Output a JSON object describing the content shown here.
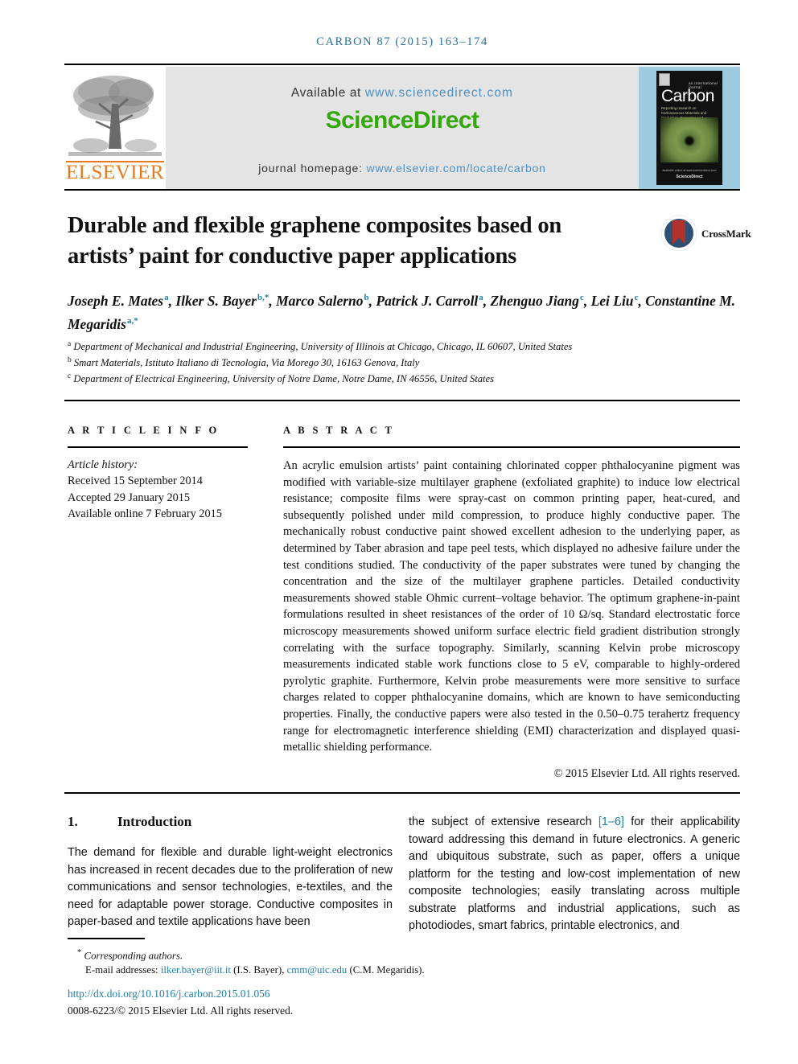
{
  "running_head": {
    "journal": "CARBON",
    "citation": "87 (2015) 163–174",
    "full": "CARBON 87 (2015) 163–174"
  },
  "banner": {
    "publisher_logo_text": "ELSEVIER",
    "available_prefix": "Available at",
    "available_url": "www.sciencedirect.com",
    "sciencedirect_wordmark": "ScienceDirect",
    "homepage_prefix": "journal homepage:",
    "homepage_url": "www.elsevier.com/locate/carbon",
    "cover": {
      "supra_title": "an international journal",
      "title": "Carbon",
      "subtitle": "Reporting research on Carbonaceous Materials and Production, Properties and Applications",
      "foot_line1": "available online at www.sciencedirect.com",
      "foot_line2": "ScienceDirect"
    }
  },
  "article": {
    "title": "Durable and flexible graphene composites based on artists’ paint for conductive paper applications",
    "crossmark_label": "CrossMark",
    "authors_line1": "Joseph E. Mates ",
    "authors": [
      {
        "name": "Joseph E. Mates",
        "marks": "a"
      },
      {
        "name": "Ilker S. Bayer",
        "marks": "b,*"
      },
      {
        "name": "Marco Salerno",
        "marks": "b"
      },
      {
        "name": "Patrick J. Carroll",
        "marks": "a"
      },
      {
        "name": "Zhenguo Jiang",
        "marks": "c"
      },
      {
        "name": "Lei Liu",
        "marks": "c"
      },
      {
        "name": "Constantine M. Megaridis",
        "marks": "a,*"
      }
    ],
    "affiliations": [
      {
        "mark": "a",
        "text": "Department of Mechanical and Industrial Engineering, University of Illinois at Chicago, Chicago, IL 60607, United States"
      },
      {
        "mark": "b",
        "text": "Smart Materials, Istituto Italiano di Tecnologia, Via Morego 30, 16163 Genova, Italy"
      },
      {
        "mark": "c",
        "text": "Department of Electrical Engineering, University of Notre Dame, Notre Dame, IN 46556, United States"
      }
    ]
  },
  "article_info": {
    "heading": "A R T I C L E   I N F O",
    "history_label": "Article history:",
    "received": "Received 15 September 2014",
    "accepted": "Accepted 29 January 2015",
    "available_online": "Available online 7 February 2015"
  },
  "abstract": {
    "heading": "A B S T R A C T",
    "text": "An acrylic emulsion artists’ paint containing chlorinated copper phthalocyanine pigment was modified with variable-size multilayer graphene (exfoliated graphite) to induce low electrical resistance; composite films were spray-cast on common printing paper, heat-cured, and subsequently polished under mild compression, to produce highly conductive paper. The mechanically robust conductive paint showed excellent adhesion to the underlying paper, as determined by Taber abrasion and tape peel tests, which displayed no adhesive failure under the test conditions studied. The conductivity of the paper substrates were tuned by changing the concentration and the size of the multilayer graphene particles. Detailed conductivity measurements showed stable Ohmic current–voltage behavior. The optimum graphene-in-paint formulations resulted in sheet resistances of the order of 10 Ω/sq. Standard electrostatic force microscopy measurements showed uniform surface electric field gradient distribution strongly correlating with the surface topography. Similarly, scanning Kelvin probe microscopy measurements indicated stable work functions close to 5 eV, comparable to highly-ordered pyrolytic graphite. Furthermore, Kelvin probe measurements were more sensitive to surface charges related to copper phthalocyanine domains, which are known to have semiconducting properties. Finally, the conductive papers were also tested in the 0.50–0.75 terahertz frequency range for electromagnetic interference shielding (EMI) characterization and displayed quasi-metallic shielding performance.",
    "copyright": "© 2015 Elsevier Ltd. All rights reserved."
  },
  "introduction": {
    "number": "1.",
    "heading": "Introduction",
    "left_column": "The demand for flexible and durable light-weight electronics has increased in recent decades due to the proliferation of new communications and sensor technologies, e-textiles, and the need for adaptable power storage. Conductive composites in paper-based and textile applications have been",
    "right_column_part1": "the subject of extensive research ",
    "right_column_ref": "[1–6]",
    "right_column_part2": " for their applicability toward addressing this demand in future electronics. A generic and ubiquitous substrate, such as paper, offers a unique platform for the testing and low-cost implementation of new composite technologies; easily translating across multiple substrate platforms and industrial applications, such as photodiodes, smart fabrics, printable electronics, and"
  },
  "footnotes": {
    "corresponding_mark": "*",
    "corresponding": "Corresponding authors.",
    "email_label": "E-mail addresses:",
    "email1": "ilker.bayer@iit.it",
    "email1_owner": "(I.S. Bayer),",
    "email2": "cmm@uic.edu",
    "email2_owner": "(C.M. Megaridis).",
    "doi": "http://dx.doi.org/10.1016/j.carbon.2015.01.056",
    "issn_line": "0008-6223/© 2015 Elsevier Ltd. All rights reserved."
  },
  "colors": {
    "link_blue": "#1d7fa8",
    "banner_link_blue": "#4C90C0",
    "sciencedirect_green": "#34A80B",
    "elsevier_orange": "#E87B19",
    "runhead_blue": "#2c6f9b",
    "crossmark_red": "#b0322a",
    "crossmark_navy": "#2f4f73",
    "banner_grey": "#e4e4e4",
    "cover_blue": "#9fcbe0"
  }
}
